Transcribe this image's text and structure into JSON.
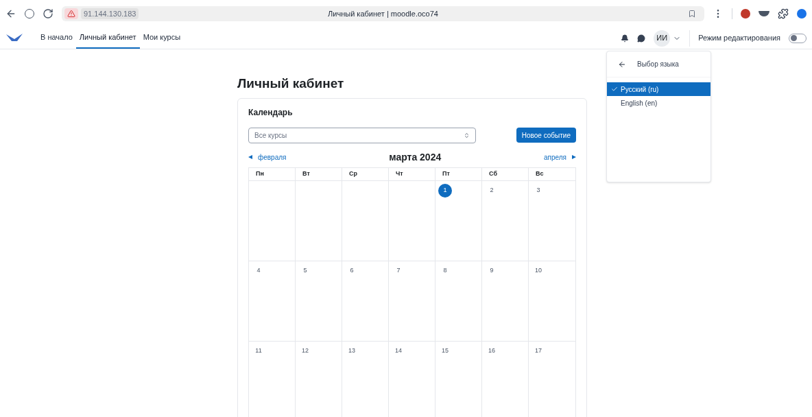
{
  "browser": {
    "url": "91.144.130.183",
    "title": "Личный кабинет | moodle.oco74"
  },
  "nav": {
    "items": [
      {
        "label": "В начало",
        "selected": false
      },
      {
        "label": "Личный кабинет",
        "selected": true
      },
      {
        "label": "Мои курсы",
        "selected": false
      }
    ],
    "avatar": "ИИ",
    "edit_mode": {
      "label": "Режим редактирования",
      "on": false
    }
  },
  "language_menu": {
    "title": "Выбор языка",
    "items": [
      {
        "label": "Русский (ru)",
        "selected": true
      },
      {
        "label": "English (en)",
        "selected": false
      }
    ]
  },
  "page": {
    "title": "Личный кабинет"
  },
  "calendar": {
    "title": "Календарь",
    "course_select": "Все курсы",
    "new_event": "Новое событие",
    "prev": "февраля",
    "month": "марта 2024",
    "next": "апреля",
    "weekdays": [
      "Пн",
      "Вт",
      "Ср",
      "Чт",
      "Пт",
      "Сб",
      "Вс"
    ],
    "weeks": [
      [
        {
          "kind": "empty"
        },
        {
          "kind": "empty"
        },
        {
          "kind": "empty"
        },
        {
          "kind": "empty"
        },
        {
          "kind": "day",
          "label": "1",
          "today": true
        },
        {
          "kind": "day",
          "label": "2",
          "today": false
        },
        {
          "kind": "day",
          "label": "3",
          "today": false
        }
      ],
      [
        {
          "kind": "day",
          "label": "4",
          "today": false
        },
        {
          "kind": "day",
          "label": "5",
          "today": false
        },
        {
          "kind": "day",
          "label": "6",
          "today": false
        },
        {
          "kind": "day",
          "label": "7",
          "today": false
        },
        {
          "kind": "day",
          "label": "8",
          "today": false
        },
        {
          "kind": "day",
          "label": "9",
          "today": false
        },
        {
          "kind": "day",
          "label": "10",
          "today": false
        }
      ],
      [
        {
          "kind": "day",
          "label": "11",
          "today": false
        },
        {
          "kind": "day",
          "label": "12",
          "today": false
        },
        {
          "kind": "day",
          "label": "13",
          "today": false
        },
        {
          "kind": "day",
          "label": "14",
          "today": false
        },
        {
          "kind": "day",
          "label": "15",
          "today": false
        },
        {
          "kind": "day",
          "label": "16",
          "today": false
        },
        {
          "kind": "day",
          "label": "17",
          "today": false
        }
      ]
    ]
  }
}
